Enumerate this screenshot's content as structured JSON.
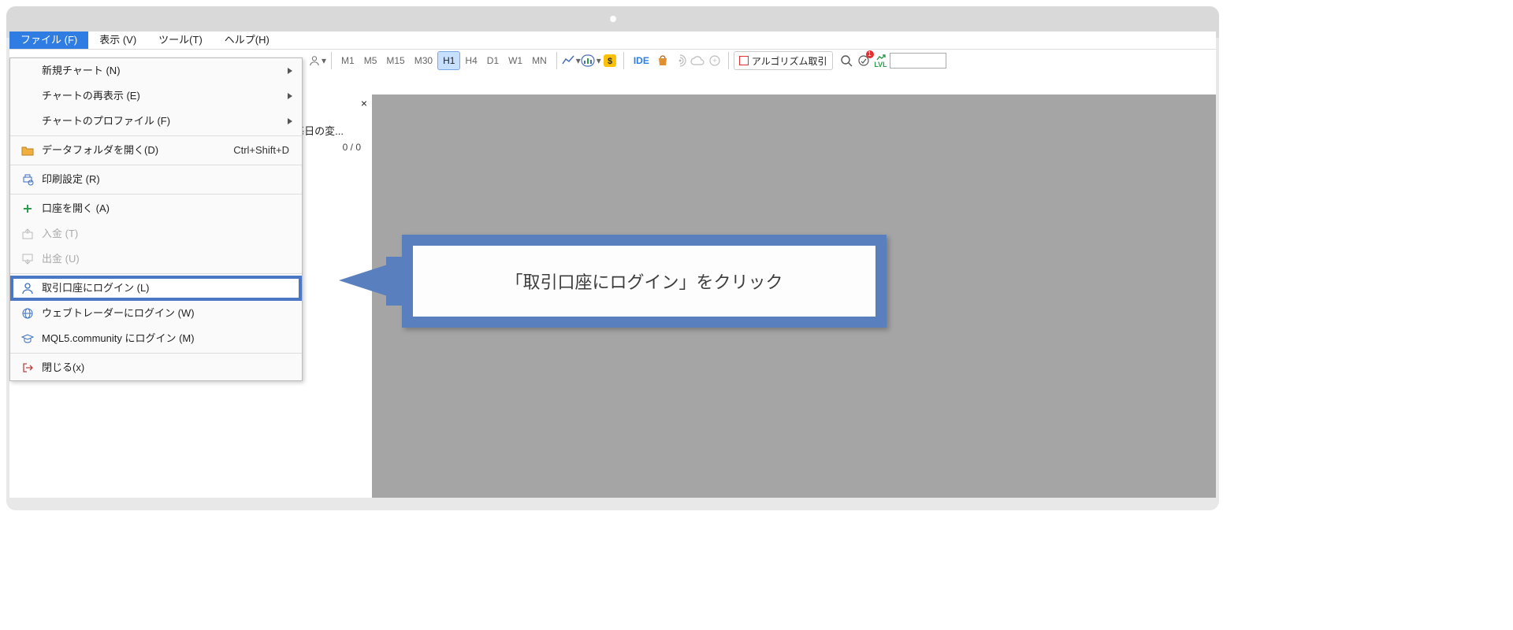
{
  "menubar": {
    "file": "ファイル (F)",
    "view": "表示 (V)",
    "tools": "ツール(T)",
    "help": "ヘルプ(H)"
  },
  "file_menu": {
    "new_chart": "新規チャート (N)",
    "reshow_chart": "チャートの再表示 (E)",
    "chart_profile": "チャートのプロファイル (F)",
    "open_data_folder": "データフォルダを開く(D)",
    "open_data_folder_sc": "Ctrl+Shift+D",
    "print_setup": "印刷設定 (R)",
    "open_account": "口座を開く (A)",
    "deposit": "入金 (T)",
    "withdraw": "出金 (U)",
    "login_trade": "取引口座にログイン (L)",
    "login_web": "ウェブトレーダーにログイン (W)",
    "login_mql5": "MQL5.community にログイン (M)",
    "close": "閉じる(x)"
  },
  "timeframes": {
    "m1": "M1",
    "m5": "M5",
    "m15": "M15",
    "m30": "M30",
    "h1": "H1",
    "h4": "H4",
    "d1": "D1",
    "w1": "W1",
    "mn": "MN"
  },
  "ide": "IDE",
  "algo": "アルゴリズム取引",
  "lvl": "LVL",
  "notif": "1",
  "panel": {
    "tab": "毎日の変...",
    "counter": "0 / 0",
    "close": "×"
  },
  "callout": "「取引口座にログイン」をクリック"
}
